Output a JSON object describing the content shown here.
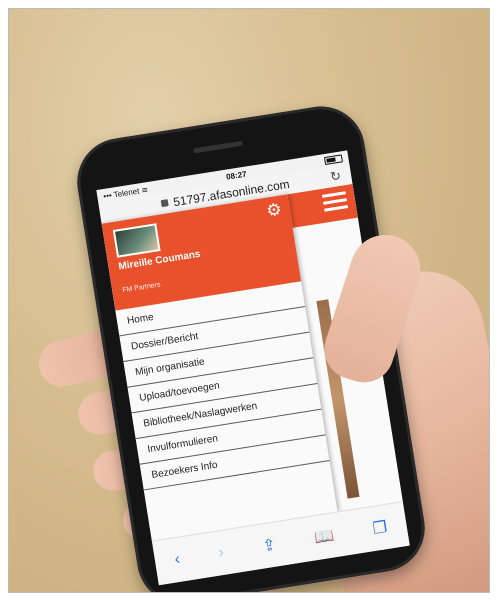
{
  "status_bar": {
    "carrier": "Telenet",
    "time": "08:27"
  },
  "browser": {
    "url": "51797.afasonline.com"
  },
  "menu": {
    "user_name": "Mireille Coumans",
    "company": "FM Partners",
    "items": [
      {
        "label": "Home"
      },
      {
        "label": "Dossier/Bericht"
      },
      {
        "label": "Mijn organisatie"
      },
      {
        "label": "Upload/toevoegen"
      },
      {
        "label": "Bibliotheek/Naslagwerken"
      },
      {
        "label": "Invulformulieren"
      },
      {
        "label": "Bezoekers Info"
      }
    ]
  },
  "icons": [
    "gear-icon",
    "hamburger-icon",
    "back-icon",
    "forward-icon",
    "share-icon",
    "bookmarks-icon",
    "tabs-icon",
    "lock-icon",
    "reload-icon",
    "wifi-icon",
    "battery-icon"
  ],
  "colors": {
    "accent": "#e8512b",
    "ios_blue": "#2d72e0"
  }
}
